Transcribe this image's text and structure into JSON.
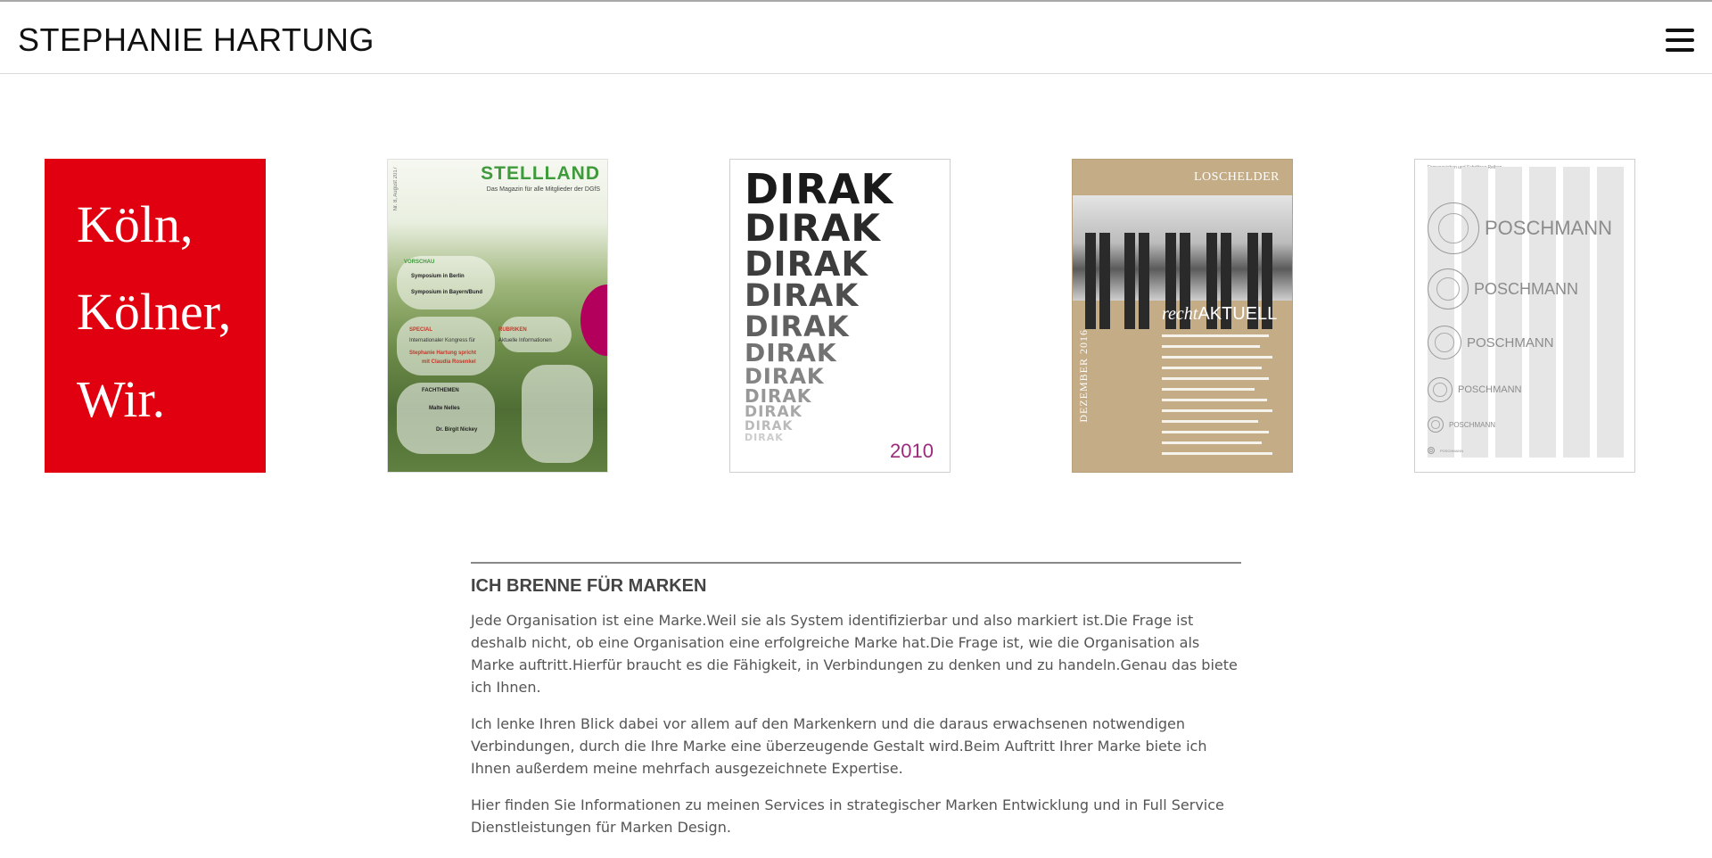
{
  "header": {
    "title": "STEPHANIE HARTUNG",
    "menu_icon": "hamburger-menu-icon"
  },
  "gallery": {
    "items": [
      {
        "name": "koeln-poster",
        "lines": [
          "Köln,",
          "Kölner,",
          "Wir."
        ],
        "color": "#e1000f"
      },
      {
        "name": "stellland-magazine",
        "title": "STELLLAND",
        "subtitle": "Das Magazin für alle Mitglieder der DGfS",
        "issue": "Nr. 8, August 2017",
        "sections": [
          {
            "label": "VORSCHAU",
            "lines": [
              "Symposium in Berlin",
              "Symposium in Bayern/Bund"
            ]
          },
          {
            "label": "SPECIAL",
            "lines": [
              "Internationaler Kongress für",
              "Stephanie Hartung spricht",
              "mit Claudia Rosenkel"
            ]
          },
          {
            "label": "RUBRIKEN",
            "lines": [
              "Aktuelle Informationen"
            ]
          },
          {
            "label": "FACHTHEMEN",
            "lines": [
              "Malte Nelles",
              "Dr. Birgit Nickey"
            ]
          }
        ],
        "color": "#3e9a3a"
      },
      {
        "name": "dirak-catalog",
        "word": "DIRAK",
        "year": "2010",
        "color": "#9b2a7d"
      },
      {
        "name": "loschelder-recht-aktuell",
        "brand": "LOSCHELDER",
        "title_italic": "recht",
        "title_bold": "AKTUELL",
        "date": "DEZEMBER 2016",
        "color": "#c4ac86"
      },
      {
        "name": "poschmann-logo-sheet",
        "header": "Firmenzeichen und Schriftzug Reihen",
        "logo_text": "POSCHMANN"
      }
    ]
  },
  "about": {
    "heading": "ICH BRENNE FÜR MARKEN",
    "paragraphs": [
      "Jede Organisation ist eine Marke.Weil sie als System identifizierbar und also markiert ist.Die Frage ist deshalb nicht, ob eine Organisation eine erfolgreiche Marke hat.Die Frage ist, wie die Organisation als Marke auftritt.Hierfür braucht es die Fähigkeit, in Verbindungen zu denken und zu handeln.Genau das biete ich Ihnen.",
      "Ich lenke Ihren Blick dabei vor allem auf den Markenkern und die daraus erwachsenen notwendigen Verbindungen, durch die Ihre Marke eine überzeugende Gestalt wird.Beim Auftritt Ihrer Marke biete ich Ihnen außerdem meine mehrfach ausgezeichnete Expertise.",
      "Hier finden Sie Informationen zu meinen Services in strategischer Marken Entwicklung und in Full Service Dienstleistungen für Marken Design."
    ]
  }
}
